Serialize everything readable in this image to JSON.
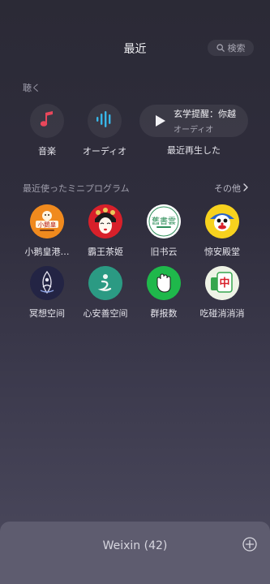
{
  "header": {
    "title": "最近",
    "search_label": "検索"
  },
  "listen": {
    "section_label": "聴く",
    "items": [
      {
        "label": "音楽",
        "icon": "music-note-icon"
      },
      {
        "label": "オーディオ",
        "icon": "audio-wave-icon"
      }
    ],
    "recent": {
      "title": "玄学提醒：你越",
      "subtitle": "オーディオ",
      "label": "最近再生した",
      "icon": "play-icon"
    }
  },
  "mini_programs": {
    "section_label": "最近使ったミニプログラム",
    "more_label": "その他",
    "apps": [
      {
        "label": "小鹅皇港…",
        "icon": "goose-logo-icon",
        "icon_text": "小鵝皇"
      },
      {
        "label": "霸王茶姬",
        "icon": "opera-face-icon"
      },
      {
        "label": "旧书云",
        "icon": "old-books-icon",
        "icon_text": "舊書雲"
      },
      {
        "label": "惊安殿堂",
        "icon": "cartoon-face-icon"
      },
      {
        "label": "冥想空间",
        "icon": "meditation-icon"
      },
      {
        "label": "心安善空间",
        "icon": "mind-logo-icon"
      },
      {
        "label": "群报数",
        "icon": "hand-count-icon"
      },
      {
        "label": "吃碰消消消",
        "icon": "mahjong-tile-icon",
        "icon_text": "中"
      }
    ]
  },
  "bottom_bar": {
    "title": "Weixin (42)"
  },
  "colors": {
    "music_accent": "#e9475b",
    "audio_accent": "#38b6e8"
  }
}
